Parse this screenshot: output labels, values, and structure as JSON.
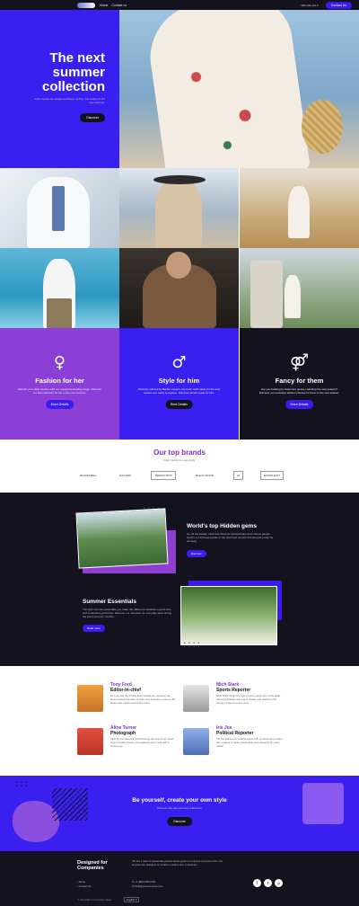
{
  "nav": {
    "links": [
      "Home",
      "Contact us"
    ],
    "select_label": "Who We Are",
    "contact_label": "Contact Us"
  },
  "hero": {
    "title": "The next summer collection",
    "subtitle": "Color trends are always exciting in spring. Get ready for the new summer.",
    "button_label": "Discover"
  },
  "categories": [
    {
      "icon": "female-sign-icon",
      "glyph": "♀",
      "title": "Fashion for her",
      "text": "Refresh your daily rotation with our newest bestselling range. Discover our last collection for her in the new summer.",
      "button": "More Details",
      "bg": "#8b3fd6",
      "btn_bg": "#3b1cf0"
    },
    {
      "icon": "male-sign-icon",
      "glyph": "♂",
      "title": "Style for him",
      "text": "Perfectly tailored by Barber experts, the fresh outfit ideas for the new season are ready to explore. Discover what's made for him.",
      "button": "Best Details",
      "bg": "#3a1ff1",
      "btn_bg": "#14121f"
    },
    {
      "icon": "gender-pair-icon",
      "glyph": "⚤",
      "title": "Fancy for them",
      "text": "Are you looking for statement pieces matching the new season? Discover our exclusive fashion choices for them in the new season.",
      "button": "More Details",
      "bg": "#15121f",
      "btn_bg": "#3b1cf0"
    }
  ],
  "brands": {
    "title": "Our top brands",
    "subtitle": "Daily trends for everybody",
    "items": [
      "BLOOM BELL",
      "SAILTRIP",
      "TRENDY BOX",
      "BLACK WOOD",
      "M",
      "MOONLIGHT"
    ]
  },
  "features": [
    {
      "title": "World's top Hidden gems",
      "text": "Go off the beaten track and discover extraordinary and curious people. Here's our full travel guide to the best kept secrets that are just a step far off away.",
      "button": "Discover"
    },
    {
      "title": "Summer Essentials",
      "text": "The light summer essentials you make the difference between a good time and a standout great time. Discover our selection for everyday wear during the warm summer months.",
      "button": "Read more"
    }
  ],
  "team": [
    {
      "name": "Tony Fred",
      "role": "Editor-in-chief",
      "text": "Tony Fred is the driving force behind the company. He loves to keep his team on their toes and has a nose for the latest style trends around the world.",
      "tone": "#f0a23a"
    },
    {
      "name": "Mich Stark",
      "role": "Sports Reporter",
      "text": "Mich Stark brings the heat of every game day to the page, following athletes and teams closely and capturing the energy of sport in every story.",
      "tone": "#c9c9c9"
    },
    {
      "name": "Aline Turner",
      "role": "Photograph",
      "text": "Aline Turner sees the world through her lens. From street style to studio shoots, she captures every look with a unique eye.",
      "tone": "#e2503f"
    },
    {
      "name": "Iris Joe",
      "role": "Political Reporter",
      "text": "Iris Joe follows the political scene with curiosity and a sharp pen, making complex topics clear and engaging for every reader.",
      "tone": "#6b8fd6"
    }
  ],
  "cta": {
    "title": "Be yourself, create your own style",
    "subtitle": "Discover the new summer collections",
    "button": "Discover"
  },
  "footer": {
    "title": "Designed for Companies",
    "text": "We are a team of passionate people whose goal is to improve everyone's life. Our services are designed for small to medium size companies.",
    "links": [
      "Home",
      "Contact Us"
    ],
    "contacts": [
      "+1 (800) 555-0100",
      "hello@yourcompany.com"
    ],
    "copyright": "© Copyright © Company name",
    "language": "English"
  }
}
